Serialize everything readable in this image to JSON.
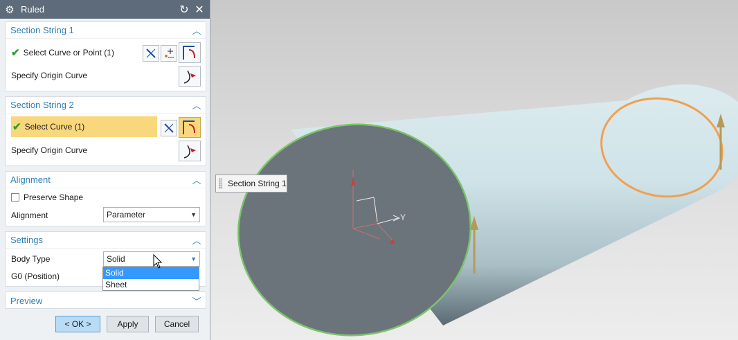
{
  "dialog": {
    "title": "Ruled",
    "section1": {
      "title": "Section String 1",
      "select_label": "Select Curve or Point (1)",
      "origin_label": "Specify Origin Curve"
    },
    "section2": {
      "title": "Section String 2",
      "select_label": "Select Curve (1)",
      "origin_label": "Specify Origin Curve"
    },
    "alignment": {
      "title": "Alignment",
      "preserve_shape_label": "Preserve Shape",
      "alignment_label": "Alignment",
      "alignment_value": "Parameter"
    },
    "settings": {
      "title": "Settings",
      "body_type_label": "Body Type",
      "body_type_value": "Solid",
      "g0_label": "G0 (Position)",
      "options": [
        "Solid",
        "Sheet"
      ]
    },
    "preview": {
      "title": "Preview"
    },
    "buttons": {
      "ok": "< OK >",
      "apply": "Apply",
      "cancel": "Cancel"
    }
  },
  "viewport": {
    "tooltip": "Section String 1",
    "axis_label": "Y",
    "colors": {
      "cylinder_face": "#6b747b",
      "cylinder_body": "#cde1e6",
      "near_edge": "#7cc46a",
      "far_edge": "#f0a050",
      "arrow": "#b49a5a"
    }
  }
}
